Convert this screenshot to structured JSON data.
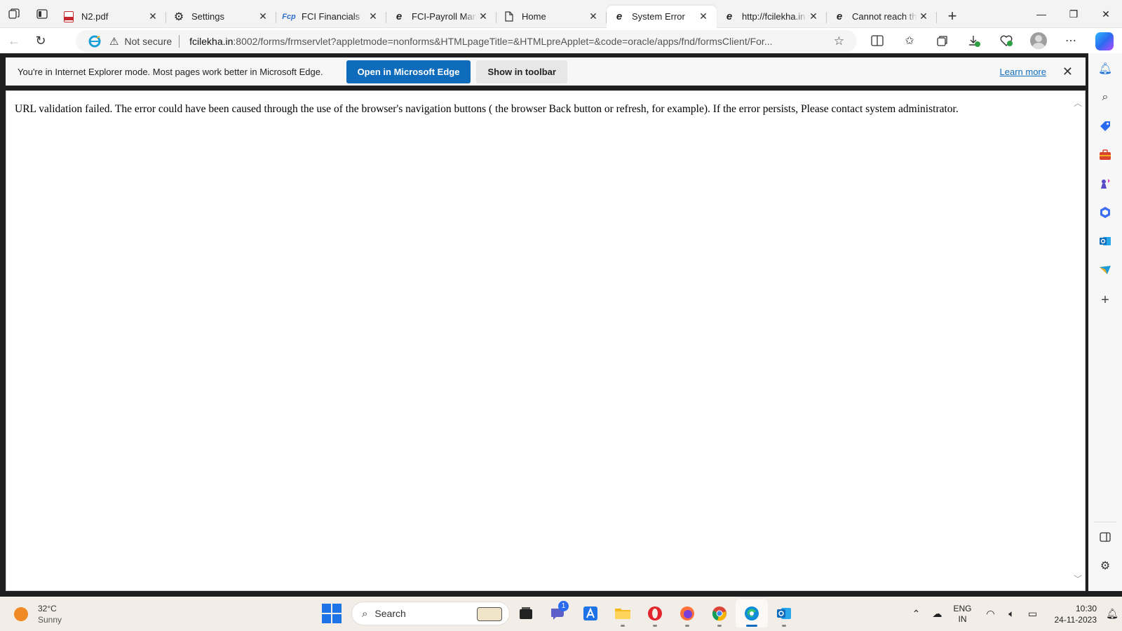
{
  "browser": {
    "tabs": [
      {
        "title": "N2.pdf",
        "icon": "pdf-icon",
        "active": false
      },
      {
        "title": "Settings",
        "icon": "gear-icon",
        "active": false
      },
      {
        "title": "FCI Financials",
        "icon": "fcp-icon",
        "active": false
      },
      {
        "title": "FCI-Payroll Management",
        "icon": "ie-icon",
        "active": false
      },
      {
        "title": "Home",
        "icon": "page-icon",
        "active": false
      },
      {
        "title": "System Error",
        "icon": "ie-icon",
        "active": true
      },
      {
        "title": "http://fcilekha.in",
        "icon": "ie-icon",
        "active": false
      },
      {
        "title": "Cannot reach this page",
        "icon": "ie-icon",
        "active": false
      }
    ],
    "new_tab": "+",
    "address": {
      "security_label": "Not secure",
      "url_host": "fcilekha.in",
      "url_rest": ":8002/forms/frmservlet?appletmode=nonforms&HTMLpageTitle=&HTMLpreApplet=&code=oracle/apps/fnd/formsClient/For..."
    }
  },
  "infobar": {
    "message": "You're in Internet Explorer mode. Most pages work better in Microsoft Edge.",
    "open_edge_label": "Open in Microsoft Edge",
    "show_toolbar_label": "Show in toolbar",
    "learn_more_label": "Learn more"
  },
  "page": {
    "error_message": "URL validation failed. The error could have been caused through the use of the browser's navigation buttons ( the browser Back button or refresh, for example). If the error persists, Please contact system administrator."
  },
  "taskbar": {
    "weather": {
      "temp": "32°C",
      "condition": "Sunny"
    },
    "search_label": "Search",
    "chat_badge": "1",
    "lang_line1": "ENG",
    "lang_line2": "IN",
    "time": "10:30",
    "date": "24-11-2023"
  },
  "colors": {
    "accent": "#0f6cbd",
    "taskbar": "#f3ede7"
  }
}
